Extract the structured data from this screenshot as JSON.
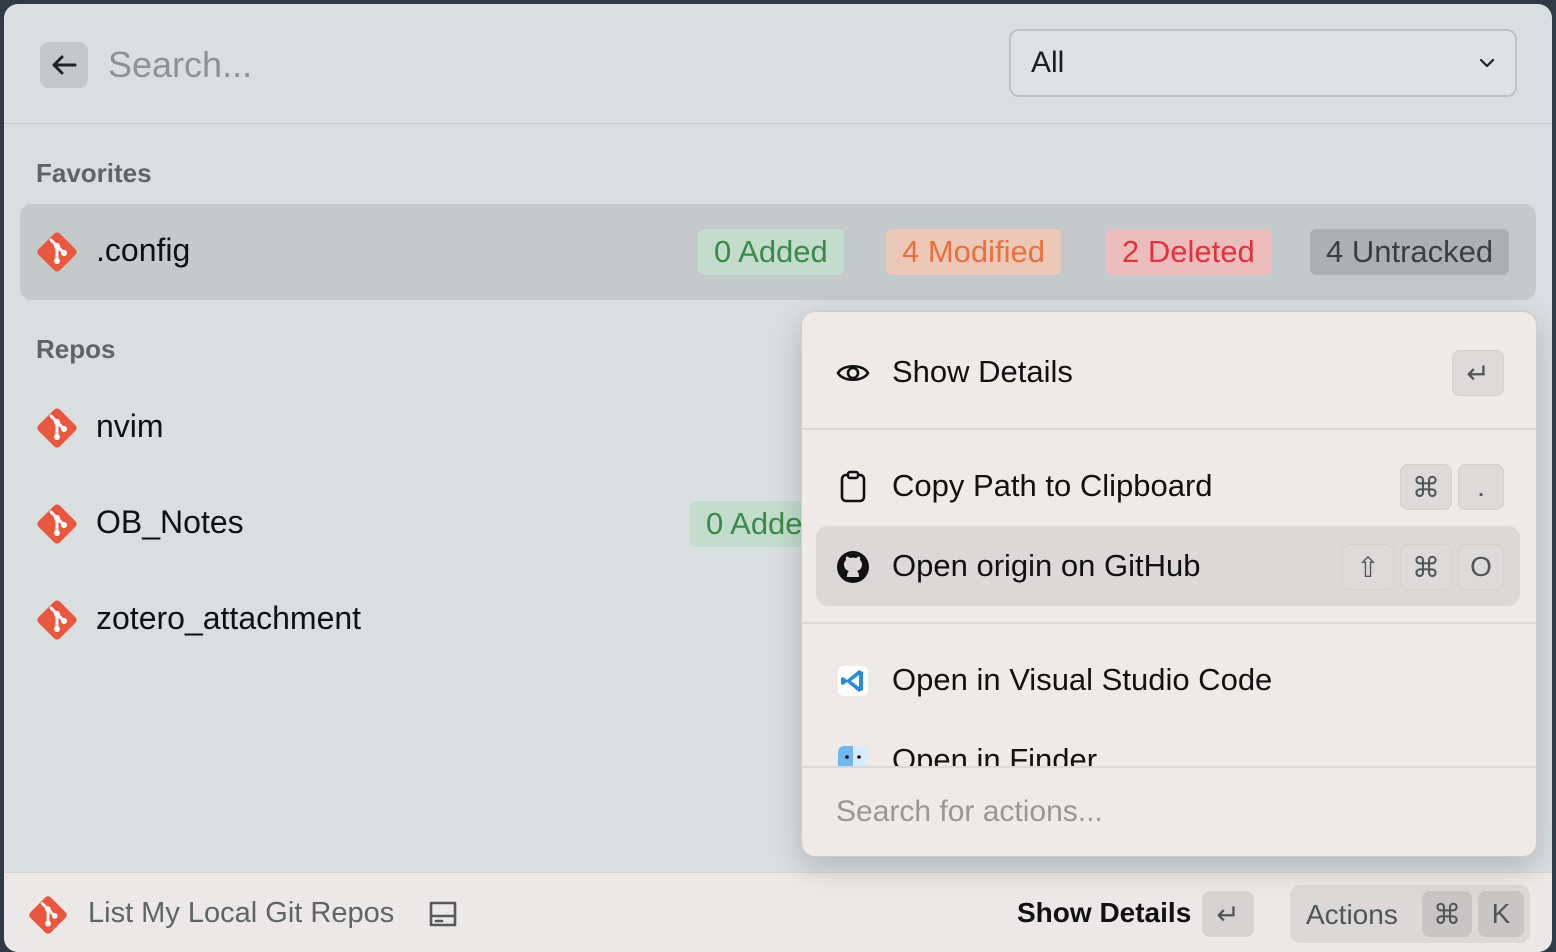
{
  "search": {
    "placeholder": "Search..."
  },
  "filter": {
    "selected": "All"
  },
  "favorites": {
    "title": "Favorites",
    "items": [
      {
        "name": ".config",
        "added": "0 Added",
        "modified": "4 Modified",
        "deleted": "2 Deleted",
        "untracked": "4 Untracked"
      }
    ]
  },
  "repos": {
    "title": "Repos",
    "items": [
      {
        "name": "nvim"
      },
      {
        "name": "OB_Notes",
        "added": "0 Adde"
      },
      {
        "name": "zotero_attachment"
      }
    ]
  },
  "actions_panel": {
    "items": [
      {
        "label": "Show Details",
        "icon": "eye-icon",
        "keys": [
          "↵"
        ]
      },
      {
        "label": "Copy Path to Clipboard",
        "icon": "clipboard-icon",
        "keys": [
          "⌘",
          "."
        ]
      },
      {
        "label": "Open origin on GitHub",
        "icon": "github-icon",
        "keys": [
          "⇧",
          "⌘",
          "O"
        ]
      },
      {
        "label": "Open in Visual Studio Code",
        "icon": "vscode-icon"
      },
      {
        "label": "Open in Finder",
        "icon": "finder-icon"
      }
    ],
    "search_placeholder": "Search for actions..."
  },
  "footer": {
    "title": "List My Local Git Repos",
    "primary_action": "Show Details",
    "primary_key": "↵",
    "actions_label": "Actions",
    "actions_keys": [
      "⌘",
      "K"
    ]
  },
  "colors": {
    "git": "#e9573f",
    "added": "#3a8a4c",
    "modified": "#e8713c",
    "deleted": "#e0343a",
    "untracked": "#3a3f43"
  }
}
